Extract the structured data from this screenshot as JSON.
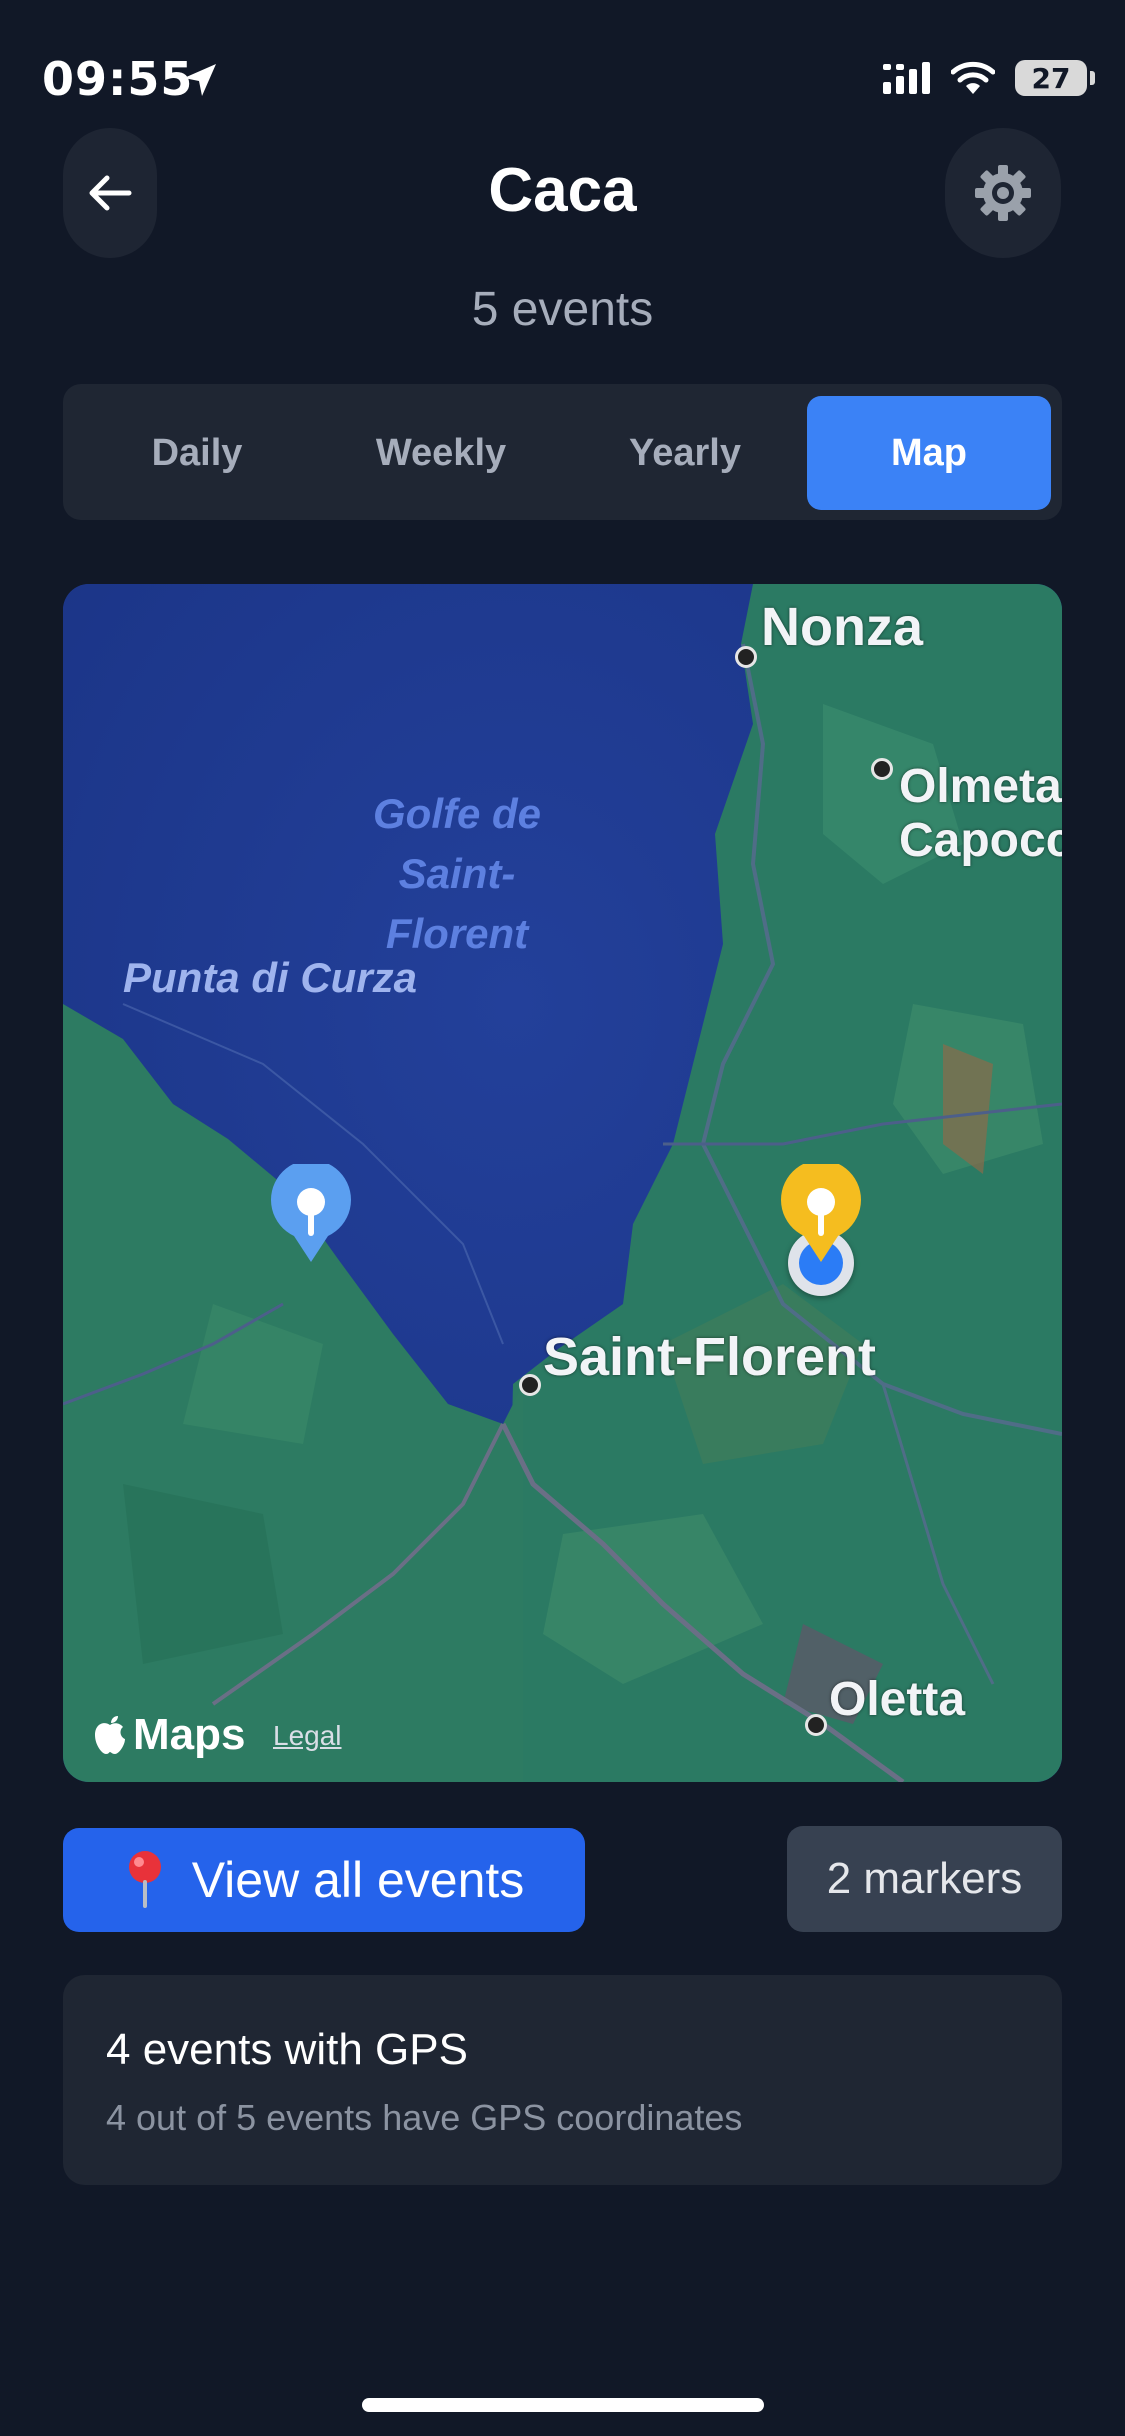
{
  "status_bar": {
    "time": "09:55",
    "battery": "27"
  },
  "header": {
    "title": "Caca",
    "subtitle": "5 events"
  },
  "tabs": [
    {
      "label": "Daily",
      "active": false
    },
    {
      "label": "Weekly",
      "active": false
    },
    {
      "label": "Yearly",
      "active": false
    },
    {
      "label": "Map",
      "active": true
    }
  ],
  "map": {
    "sea_label": "Golfe de Saint- Florent",
    "sea_label_lines": [
      "Golfe de",
      "Saint-",
      "Florent"
    ],
    "cape_label": "Punta di Curza",
    "towns": {
      "nonza": "Nonza",
      "olmeta_line1": "Olmeta",
      "olmeta_line2": "Capocc",
      "saint_florent": "Saint-Florent",
      "oletta": "Oletta"
    },
    "markers": [
      {
        "color": "#5b9ff0",
        "name": "blue-marker"
      },
      {
        "color": "#f5bd1f",
        "name": "yellow-marker"
      }
    ],
    "attribution": "Maps",
    "legal": "Legal"
  },
  "actions": {
    "view_all_icon": "pin-icon",
    "view_all_label": "View all events",
    "markers_count": "2 markers"
  },
  "gps_card": {
    "title": "4 events with GPS",
    "subtitle": "4 out of 5 events have GPS coordinates"
  },
  "colors": {
    "background": "#111827",
    "accent": "#3b82f6",
    "button_primary": "#2563eb",
    "card": "#1f2633"
  }
}
